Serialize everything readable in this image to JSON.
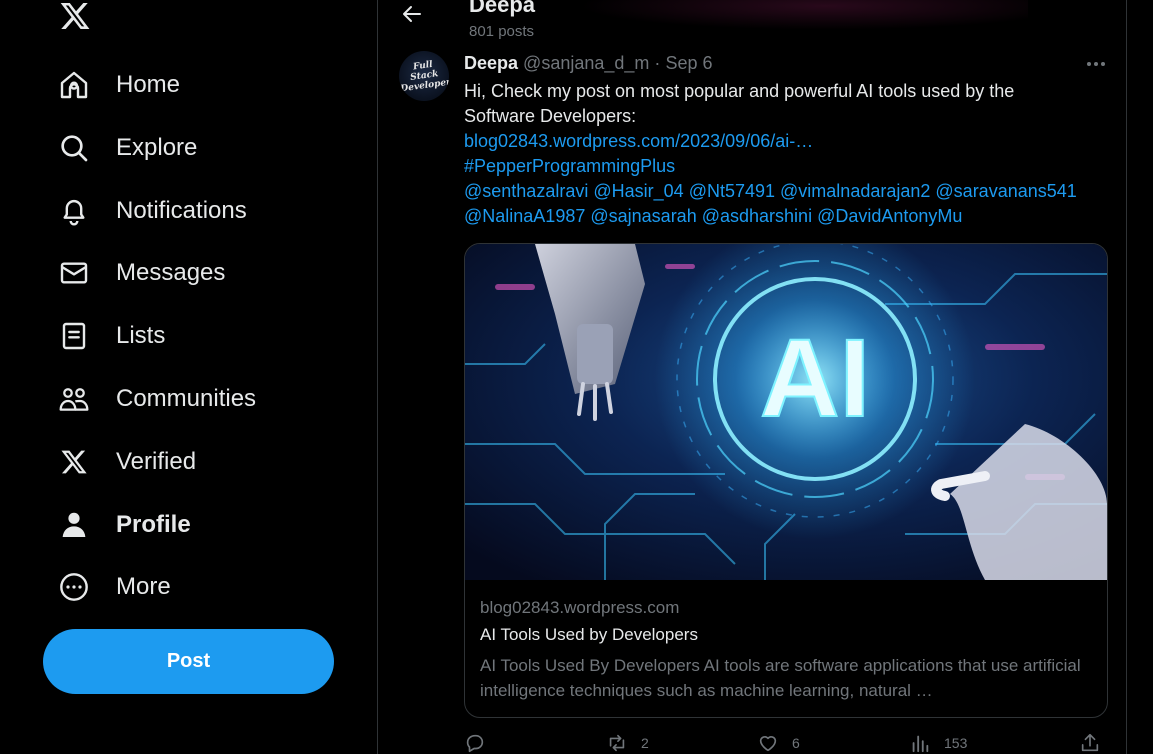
{
  "nav": {
    "items": [
      {
        "label": "Home",
        "icon": "home-icon"
      },
      {
        "label": "Explore",
        "icon": "search-icon"
      },
      {
        "label": "Notifications",
        "icon": "bell-icon"
      },
      {
        "label": "Messages",
        "icon": "envelope-icon"
      },
      {
        "label": "Lists",
        "icon": "list-icon"
      },
      {
        "label": "Communities",
        "icon": "people-icon"
      },
      {
        "label": "Verified",
        "icon": "x-logo-icon"
      },
      {
        "label": "Profile",
        "icon": "person-icon"
      },
      {
        "label": "More",
        "icon": "more-circle-icon"
      }
    ],
    "post_label": "Post"
  },
  "header": {
    "name": "Deepa",
    "post_count": "801 posts"
  },
  "tweet": {
    "avatar_text": "Full Stack Developer",
    "author_name": "Deepa",
    "handle": "@sanjana_d_m",
    "separator": "·",
    "date": "Sep 6",
    "text_line1": "Hi, Check my post on most popular and powerful AI tools used by the",
    "text_line2": "Software Developers:",
    "link": "blog02843.wordpress.com/2023/09/06/ai-…",
    "hashtag": "#PepperProgrammingPlus",
    "mentions_line1": [
      "@senthazalravi",
      "@Hasir_04",
      "@Nt57491",
      "@vimalnadarajan2",
      "@saravanans541"
    ],
    "mentions_line2": [
      "@NalinaA1987",
      "@sajnasarah",
      "@asdharshini",
      "@DavidAntonyMu"
    ]
  },
  "card": {
    "image_text": "AI",
    "domain": "blog02843.wordpress.com",
    "title": "AI Tools Used by Developers",
    "description": "AI Tools Used By Developers AI tools are software applications that use artificial intelligence techniques such as machine learning, natural …"
  },
  "actions": {
    "reply_count": "",
    "repost_count": "2",
    "like_count": "6",
    "views_count": "153"
  },
  "colors": {
    "accent": "#1d9bf0",
    "background": "#000000",
    "text": "#e7e9ea",
    "muted": "#71767b",
    "border": "#2f3336"
  }
}
